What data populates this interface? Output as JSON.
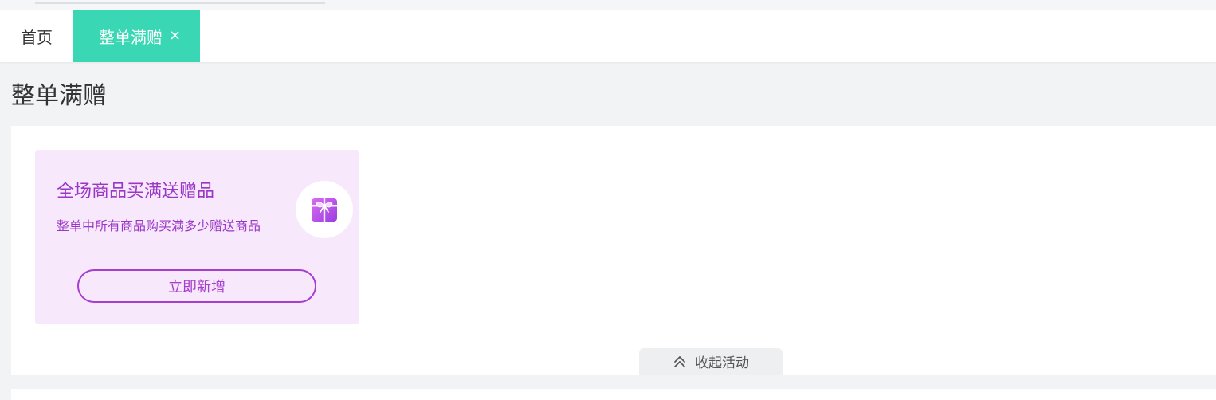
{
  "tabs": {
    "home_label": "首页",
    "active_label": "整单满赠",
    "close_symbol": "×"
  },
  "page": {
    "title": "整单满赠"
  },
  "card": {
    "title": "全场商品买满送赠品",
    "description": "整单中所有商品购买满多少赠送商品",
    "button_label": "立即新增",
    "icon": "gift-icon",
    "accent_color": "#a83ecf",
    "background_color": "#f7e8fc"
  },
  "collapse": {
    "label": "收起活动",
    "icon": "double-chevron-up-icon"
  },
  "colors": {
    "tab_active": "#3ad7b4"
  }
}
